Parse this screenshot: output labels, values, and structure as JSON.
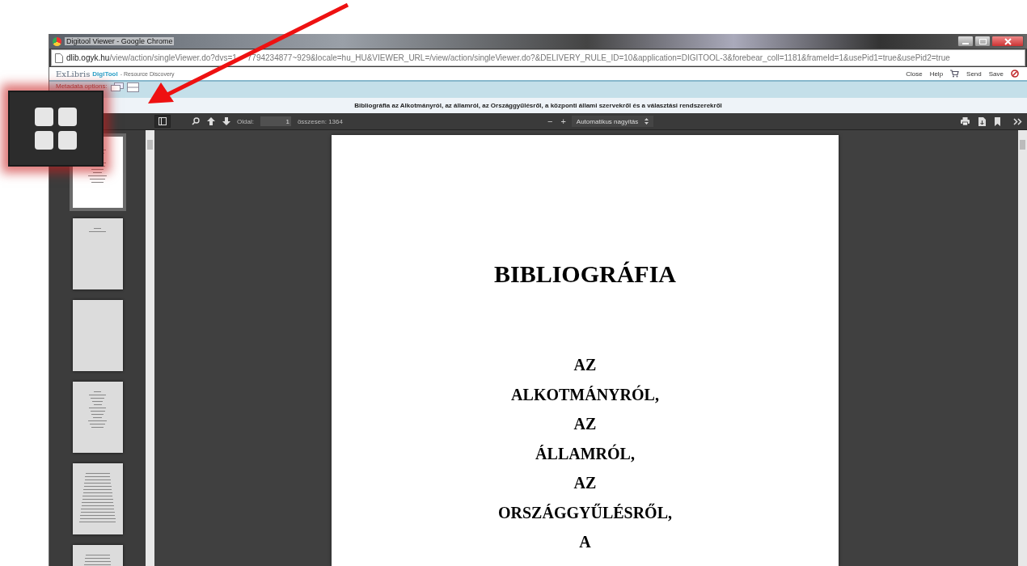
{
  "window": {
    "title": "Digitool Viewer - Google Chrome"
  },
  "address_bar": {
    "url_start": "dlib.ogyk.hu/view/action/singleViewer.do?dvs=1",
    "url_end": "7794234877~929&locale=hu_HU&VIEWER_URL=/view/action/singleViewer.do?&DELIVERY_RULE_ID=10&application=DIGITOOL-3&forebear_coll=1181&frameId=1&usePid1=true&usePid2=true"
  },
  "header": {
    "logo_ex": "ExLibris",
    "logo_product": "DigiTool",
    "subtitle": "- Resource Discovery",
    "links": [
      {
        "kind": "text",
        "label": "Close"
      },
      {
        "kind": "text",
        "label": "Help"
      },
      {
        "kind": "cart"
      },
      {
        "kind": "text",
        "label": "Send"
      },
      {
        "kind": "text",
        "label": "Save"
      },
      {
        "kind": "logout"
      }
    ]
  },
  "metadata_bar": {
    "label": "Metadata options:"
  },
  "document_title": "Bibliográfia az Alkotmányról, az államról, az Országgyűlésről, a központi állami szervekről és a választási rendszerekről",
  "toolbar": {
    "page_label": "Oldal:",
    "page_value": "1",
    "total": "összesen: 1364",
    "zoom_out": "−",
    "zoom_in": "+",
    "zoom_select": "Automatikus nagyítás"
  },
  "thumbnails": [
    {
      "selected": true
    },
    {
      "selected": false
    },
    {
      "selected": false
    },
    {
      "selected": false
    },
    {
      "selected": false
    },
    {
      "selected": false
    }
  ],
  "page": {
    "heading": "BIBLIOGRÁFIA",
    "lines": [
      "AZ",
      "ALKOTMÁNYRÓL,",
      "AZ",
      "ÁLLAMRÓL,",
      "AZ",
      "ORSZÁGGYŰLÉSRŐL,",
      "A"
    ]
  }
}
